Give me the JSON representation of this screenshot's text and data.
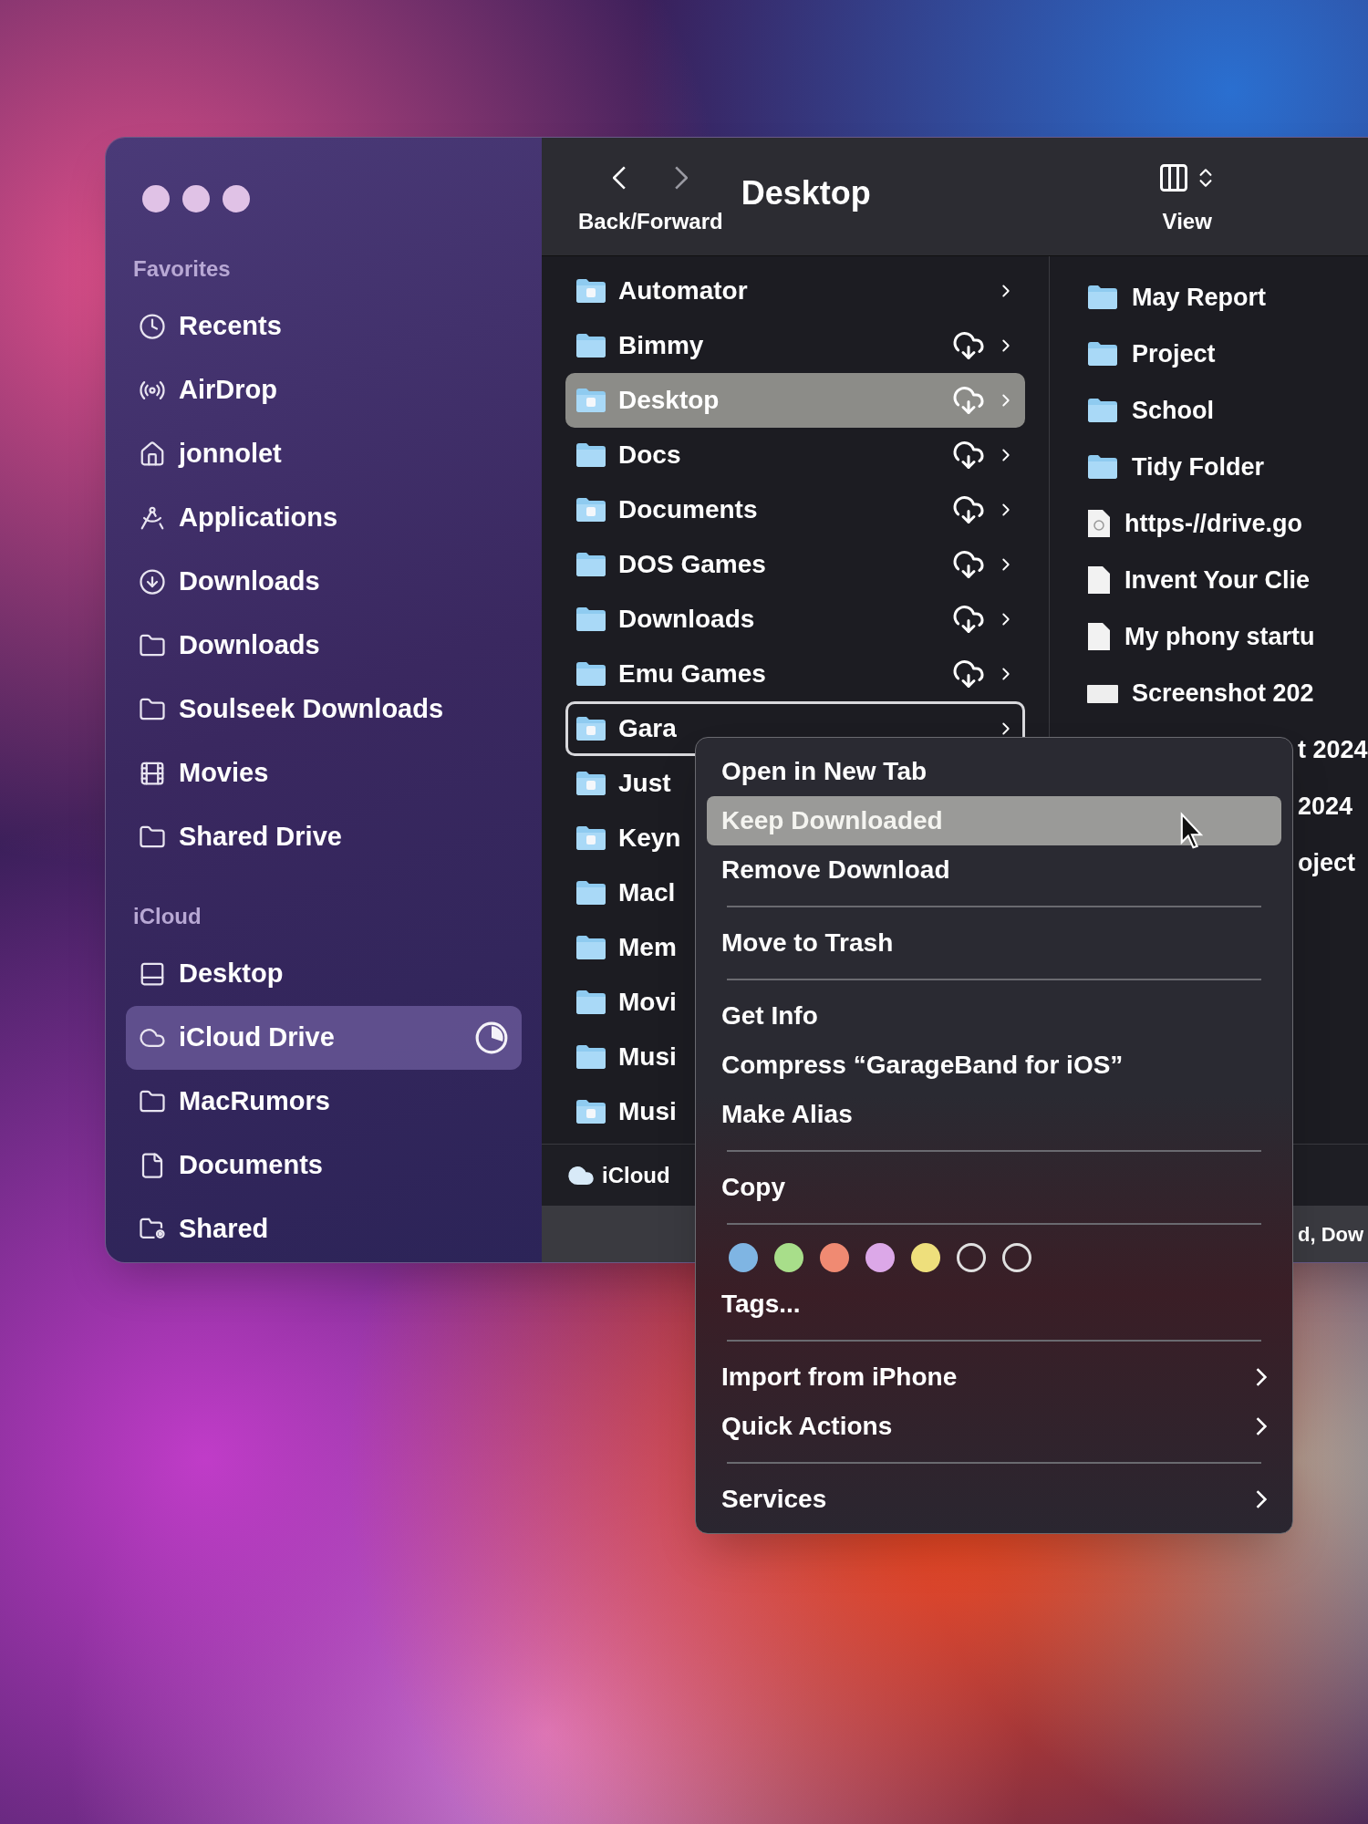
{
  "toolbar": {
    "title": "Desktop",
    "nav_label": "Back/Forward",
    "view_label": "View"
  },
  "sidebar": {
    "sections": [
      {
        "heading": "Favorites",
        "items": [
          {
            "label": "Recents",
            "kind": "clock",
            "selected": false
          },
          {
            "label": "AirDrop",
            "kind": "airdrop",
            "selected": false
          },
          {
            "label": "jonnolet",
            "kind": "home",
            "selected": false
          },
          {
            "label": "Applications",
            "kind": "apps",
            "selected": false
          },
          {
            "label": "Downloads",
            "kind": "download",
            "selected": false
          },
          {
            "label": "Downloads",
            "kind": "folder",
            "selected": false
          },
          {
            "label": "Soulseek Downloads",
            "kind": "folder",
            "selected": false
          },
          {
            "label": "Movies",
            "kind": "film",
            "selected": false
          },
          {
            "label": "Shared Drive",
            "kind": "folder",
            "selected": false
          }
        ]
      },
      {
        "heading": "iCloud",
        "items": [
          {
            "label": "Desktop",
            "kind": "desktop",
            "selected": false
          },
          {
            "label": "iCloud Drive",
            "kind": "cloud",
            "selected": true,
            "sync": true
          },
          {
            "label": "MacRumors",
            "kind": "folder",
            "selected": false
          },
          {
            "label": "Documents",
            "kind": "document",
            "selected": false
          },
          {
            "label": "Shared",
            "kind": "shared",
            "selected": false
          }
        ]
      }
    ]
  },
  "column_1": [
    {
      "name": "Automator",
      "kind": "app-folder",
      "cloud": false,
      "selected": false,
      "outlined": false
    },
    {
      "name": "Bimmy",
      "kind": "folder",
      "cloud": true,
      "selected": false,
      "outlined": false
    },
    {
      "name": "Desktop",
      "kind": "app-folder",
      "cloud": true,
      "selected": true,
      "outlined": false
    },
    {
      "name": "Docs",
      "kind": "folder",
      "cloud": true,
      "selected": false,
      "outlined": false
    },
    {
      "name": "Documents",
      "kind": "app-folder",
      "cloud": true,
      "selected": false,
      "outlined": false
    },
    {
      "name": "DOS Games",
      "kind": "folder",
      "cloud": true,
      "selected": false,
      "outlined": false
    },
    {
      "name": "Downloads",
      "kind": "folder",
      "cloud": true,
      "selected": false,
      "outlined": false
    },
    {
      "name": "Emu Games",
      "kind": "folder",
      "cloud": true,
      "selected": false,
      "outlined": false
    },
    {
      "name": "Gara",
      "kind": "app-folder",
      "cloud": false,
      "selected": false,
      "outlined": true
    },
    {
      "name": "Just",
      "kind": "app-folder",
      "cloud": false,
      "selected": false,
      "outlined": false
    },
    {
      "name": "Keyn",
      "kind": "app-folder",
      "cloud": false,
      "selected": false,
      "outlined": false
    },
    {
      "name": "Macl",
      "kind": "folder",
      "cloud": false,
      "selected": false,
      "outlined": false
    },
    {
      "name": "Mem",
      "kind": "folder",
      "cloud": false,
      "selected": false,
      "outlined": false
    },
    {
      "name": "Movi",
      "kind": "folder",
      "cloud": false,
      "selected": false,
      "outlined": false
    },
    {
      "name": "Musi",
      "kind": "folder",
      "cloud": false,
      "selected": false,
      "outlined": false
    },
    {
      "name": "Musi",
      "kind": "app-folder",
      "cloud": false,
      "selected": false,
      "outlined": false
    }
  ],
  "column_2": [
    {
      "name": "May Report",
      "kind": "folder"
    },
    {
      "name": "Project",
      "kind": "folder"
    },
    {
      "name": "School",
      "kind": "folder"
    },
    {
      "name": "Tidy Folder",
      "kind": "folder"
    },
    {
      "name": "https-//drive.go",
      "kind": "link"
    },
    {
      "name": "Invent Your Clie",
      "kind": "document"
    },
    {
      "name": "My phony startu",
      "kind": "document"
    },
    {
      "name": "Screenshot 202",
      "kind": "image"
    },
    {
      "name": "t 2024",
      "kind": "covered"
    },
    {
      "name": "2024",
      "kind": "covered"
    },
    {
      "name": "oject",
      "kind": "covered"
    }
  ],
  "path_bar": {
    "label": "iCloud"
  },
  "status_bar": {
    "text": "d, Dow"
  },
  "context_menu": [
    {
      "kind": "item",
      "label": "Open in New Tab",
      "selected": false,
      "submenu": false
    },
    {
      "kind": "item",
      "label": "Keep Downloaded",
      "selected": true,
      "submenu": false
    },
    {
      "kind": "item",
      "label": "Remove Download",
      "selected": false,
      "submenu": false
    },
    {
      "kind": "separator"
    },
    {
      "kind": "item",
      "label": "Move to Trash",
      "selected": false,
      "submenu": false
    },
    {
      "kind": "separator"
    },
    {
      "kind": "item",
      "label": "Get Info",
      "selected": false,
      "submenu": false
    },
    {
      "kind": "item",
      "label": "Compress “GarageBand for iOS”",
      "selected": false,
      "submenu": false
    },
    {
      "kind": "item",
      "label": "Make Alias",
      "selected": false,
      "submenu": false
    },
    {
      "kind": "separator"
    },
    {
      "kind": "item",
      "label": "Copy",
      "selected": false,
      "submenu": false
    },
    {
      "kind": "separator"
    },
    {
      "kind": "tags",
      "tags": [
        {
          "kind": "filled",
          "color": "#7fb5e3"
        },
        {
          "kind": "filled",
          "color": "#a8de8a"
        },
        {
          "kind": "filled",
          "color": "#f08a72"
        },
        {
          "kind": "filled",
          "color": "#dca8e8"
        },
        {
          "kind": "filled",
          "color": "#eedf7c"
        },
        {
          "kind": "empty"
        },
        {
          "kind": "empty"
        }
      ]
    },
    {
      "kind": "item",
      "label": "Tags...",
      "selected": false,
      "submenu": false
    },
    {
      "kind": "separator"
    },
    {
      "kind": "item",
      "label": "Import from iPhone",
      "selected": false,
      "submenu": true
    },
    {
      "kind": "item",
      "label": "Quick Actions",
      "selected": false,
      "submenu": true
    },
    {
      "kind": "separator"
    },
    {
      "kind": "item",
      "label": "Services",
      "selected": false,
      "submenu": true
    }
  ]
}
